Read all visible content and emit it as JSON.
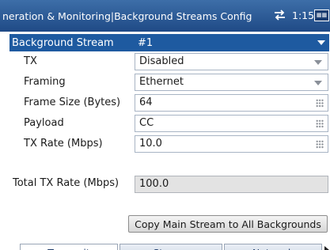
{
  "titlebar": {
    "title": "neration & Monitoring|Background Streams Config",
    "connection_icon": "network-arrows-icon",
    "time": "1:15",
    "keyboard_icon": "keyboard-icon"
  },
  "header": {
    "label": "Background Stream",
    "value": "#1"
  },
  "fields": {
    "tx": {
      "label": "TX",
      "value": "Disabled"
    },
    "framing": {
      "label": "Framing",
      "value": "Ethernet"
    },
    "frame_size": {
      "label": "Frame Size (Bytes)",
      "value": "64"
    },
    "payload": {
      "label": "Payload",
      "value": "CC"
    },
    "tx_rate": {
      "label": "TX Rate (Mbps)",
      "value": "10.0"
    }
  },
  "total": {
    "label": "Total TX Rate (Mbps)",
    "value": "100.0"
  },
  "copy_button": "Copy Main Stream to All Backgrounds",
  "tabs": [
    "Transmit",
    "Stream",
    "Network"
  ],
  "colors": {
    "titlebar": "#2a5a96",
    "header_row": "#1e5aa0",
    "field_border": "#a8b4c4",
    "readonly_bg": "#e3e3e3"
  }
}
